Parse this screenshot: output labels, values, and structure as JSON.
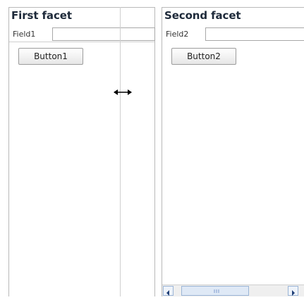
{
  "facets": [
    {
      "title": "First facet",
      "field_label": "Field1",
      "field_value": "",
      "button_label": "Button1"
    },
    {
      "title": "Second facet",
      "field_label": "Field2",
      "field_value": "",
      "button_label": "Button2"
    }
  ],
  "cursor": "resize-horizontal-icon"
}
